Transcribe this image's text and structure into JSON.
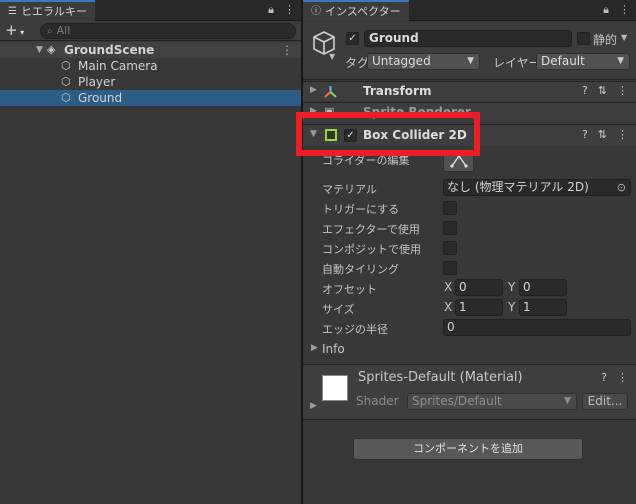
{
  "hierarchy": {
    "tab_label": "ヒエラルキー",
    "search_placeholder": "All",
    "scene": "GroundScene",
    "items": [
      {
        "label": "Main Camera"
      },
      {
        "label": "Player"
      },
      {
        "label": "Ground"
      }
    ],
    "selected": "Ground"
  },
  "inspector": {
    "tab_label": "インスペクター",
    "object_name": "Ground",
    "static_label": "静的",
    "tag_label": "タグ",
    "tag_value": "Untagged",
    "layer_label": "レイヤー",
    "layer_value": "Default",
    "components": [
      {
        "name": "Transform"
      },
      {
        "name": "Sprite Renderer"
      },
      {
        "name": "Box Collider 2D",
        "enabled": true
      }
    ],
    "collider": {
      "edit_label": "コライダーの編集",
      "material_label": "マテリアル",
      "material_value": "なし (物理マテリアル 2D)",
      "trigger_label": "トリガーにする",
      "effector_label": "エフェクターで使用",
      "composite_label": "コンポジットで使用",
      "autotiling_label": "自動タイリング",
      "offset_label": "オフセット",
      "offset_x": "0",
      "offset_y": "0",
      "size_label": "サイズ",
      "size_x": "1",
      "size_y": "1",
      "edge_label": "エッジの半径",
      "edge_value": "0",
      "info_label": "Info",
      "x_label": "X",
      "y_label": "Y"
    },
    "material": {
      "title": "Sprites-Default (Material)",
      "shader_label": "Shader",
      "shader_value": "Sprites/Default",
      "edit_label": "Edit..."
    },
    "add_component_label": "コンポーネントを追加"
  },
  "colors": {
    "highlight": "#ee1c25",
    "selection": "#2c5d87",
    "collider_icon": "#9bd44a"
  }
}
